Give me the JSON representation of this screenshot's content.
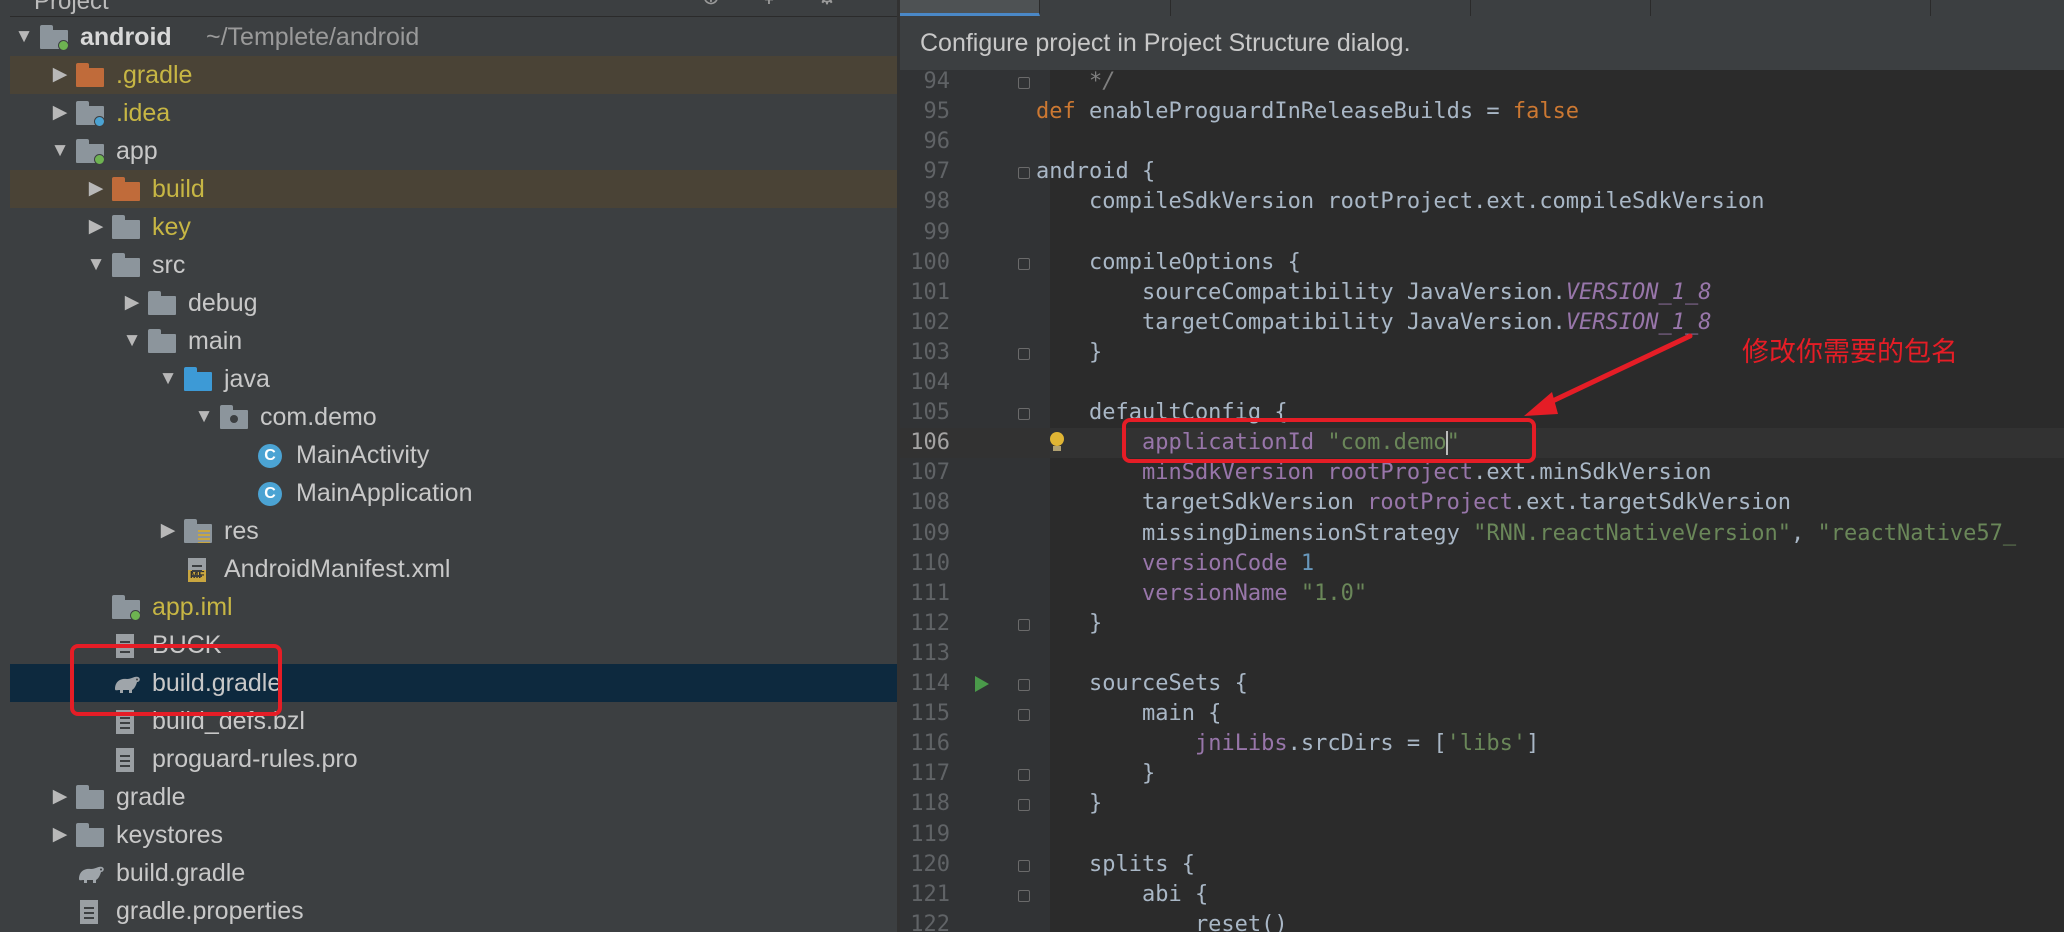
{
  "panel": {
    "title": "Project",
    "tree": [
      {
        "label": "android",
        "path": "~/Templete/android",
        "depth": 0,
        "arrow": "open",
        "icon": "module-folder"
      },
      {
        "label": ".gradle",
        "depth": 1,
        "arrow": "closed",
        "icon": "folder-orange",
        "color": "yellow",
        "highlight": true
      },
      {
        "label": ".idea",
        "depth": 1,
        "arrow": "closed",
        "icon": "idea-folder",
        "color": "yellow"
      },
      {
        "label": "app",
        "depth": 1,
        "arrow": "open",
        "icon": "module-folder"
      },
      {
        "label": "build",
        "depth": 2,
        "arrow": "closed",
        "icon": "folder-orange",
        "color": "yellow",
        "highlight": true
      },
      {
        "label": "key",
        "depth": 2,
        "arrow": "closed",
        "icon": "folder",
        "color": "yellow"
      },
      {
        "label": "src",
        "depth": 2,
        "arrow": "open",
        "icon": "folder"
      },
      {
        "label": "debug",
        "depth": 3,
        "arrow": "closed",
        "icon": "folder"
      },
      {
        "label": "main",
        "depth": 3,
        "arrow": "open",
        "icon": "folder"
      },
      {
        "label": "java",
        "depth": 4,
        "arrow": "open",
        "icon": "folder-blue"
      },
      {
        "label": "com.demo",
        "depth": 5,
        "arrow": "open",
        "icon": "package"
      },
      {
        "label": "MainActivity",
        "depth": 6,
        "icon": "class"
      },
      {
        "label": "MainApplication",
        "depth": 6,
        "icon": "class"
      },
      {
        "label": "res",
        "depth": 4,
        "arrow": "closed",
        "icon": "res-folder"
      },
      {
        "label": "AndroidManifest.xml",
        "depth": 4,
        "icon": "manifest"
      },
      {
        "label": "app.iml",
        "depth": 2,
        "icon": "module-file",
        "color": "yellow"
      },
      {
        "label": "BUCK",
        "depth": 2,
        "icon": "file"
      },
      {
        "label": "build.gradle",
        "depth": 2,
        "icon": "gradle",
        "selected": true
      },
      {
        "label": "build_defs.bzl",
        "depth": 2,
        "icon": "file"
      },
      {
        "label": "proguard-rules.pro",
        "depth": 2,
        "icon": "file"
      },
      {
        "label": "gradle",
        "depth": 1,
        "arrow": "closed",
        "icon": "folder"
      },
      {
        "label": "keystores",
        "depth": 1,
        "arrow": "closed",
        "icon": "folder"
      },
      {
        "label": "build.gradle",
        "depth": 1,
        "icon": "gradle"
      },
      {
        "label": "gradle.properties",
        "depth": 1,
        "icon": "properties"
      }
    ]
  },
  "editor": {
    "banner": "Configure project in Project Structure dialog.",
    "current_line": "106",
    "lines": [
      {
        "n": "94",
        "parts": [
          [
            "cm",
            "    */"
          ]
        ]
      },
      {
        "n": "95",
        "parts": [
          [
            "kw",
            "def "
          ],
          [
            "",
            "enableProguardInReleaseBuilds = "
          ],
          [
            "kw",
            "false"
          ]
        ]
      },
      {
        "n": "96",
        "parts": []
      },
      {
        "n": "97",
        "parts": [
          [
            "",
            "android {"
          ]
        ]
      },
      {
        "n": "98",
        "parts": [
          [
            "",
            "    compileSdkVersion rootProject.ext.compileSdkVersion"
          ]
        ]
      },
      {
        "n": "99",
        "parts": []
      },
      {
        "n": "100",
        "parts": [
          [
            "",
            "    compileOptions {"
          ]
        ]
      },
      {
        "n": "101",
        "parts": [
          [
            "",
            "        sourceCompatibility JavaVersion."
          ],
          [
            "it",
            "VERSION_1_8"
          ]
        ]
      },
      {
        "n": "102",
        "parts": [
          [
            "",
            "        targetCompatibility JavaVersion."
          ],
          [
            "it",
            "VERSION_1_8"
          ]
        ]
      },
      {
        "n": "103",
        "parts": [
          [
            "",
            "    }"
          ]
        ]
      },
      {
        "n": "104",
        "parts": []
      },
      {
        "n": "105",
        "parts": [
          [
            "",
            "    defaultConfig {"
          ]
        ]
      },
      {
        "n": "106",
        "parts": [
          [
            "",
            "        "
          ],
          [
            "prop",
            "applicationId "
          ],
          [
            "str",
            "\"com.demo"
          ],
          [
            "caret",
            ""
          ],
          [
            "str",
            "\""
          ]
        ]
      },
      {
        "n": "107",
        "parts": [
          [
            "",
            "        "
          ],
          [
            "prop",
            "minSdkVersion "
          ],
          [
            "prop",
            "rootProject"
          ],
          [
            "",
            ".ext.minSdkVersion"
          ]
        ]
      },
      {
        "n": "108",
        "parts": [
          [
            "",
            "        targetSdkVersion "
          ],
          [
            "prop",
            "rootProject"
          ],
          [
            "",
            ".ext.targetSdkVersion"
          ]
        ]
      },
      {
        "n": "109",
        "parts": [
          [
            "",
            "        missingDimensionStrategy "
          ],
          [
            "str",
            "\"RNN.reactNativeVersion\""
          ],
          [
            "",
            ", "
          ],
          [
            "str",
            "\"reactNative57_"
          ]
        ]
      },
      {
        "n": "110",
        "parts": [
          [
            "",
            "        "
          ],
          [
            "prop",
            "versionCode "
          ],
          [
            "num",
            "1"
          ]
        ]
      },
      {
        "n": "111",
        "parts": [
          [
            "",
            "        "
          ],
          [
            "prop",
            "versionName "
          ],
          [
            "str",
            "\"1.0\""
          ]
        ]
      },
      {
        "n": "112",
        "parts": [
          [
            "",
            "    }"
          ]
        ]
      },
      {
        "n": "113",
        "parts": []
      },
      {
        "n": "114",
        "parts": [
          [
            "",
            "    sourceSets {"
          ]
        ]
      },
      {
        "n": "115",
        "parts": [
          [
            "",
            "        main {"
          ]
        ]
      },
      {
        "n": "116",
        "parts": [
          [
            "",
            "            "
          ],
          [
            "prop",
            "jniLibs"
          ],
          [
            "",
            ".srcDirs = ["
          ],
          [
            "str",
            "'libs'"
          ],
          [
            "",
            "]"
          ]
        ]
      },
      {
        "n": "117",
        "parts": [
          [
            "",
            "        }"
          ]
        ]
      },
      {
        "n": "118",
        "parts": [
          [
            "",
            "    }"
          ]
        ]
      },
      {
        "n": "119",
        "parts": []
      },
      {
        "n": "120",
        "parts": [
          [
            "",
            "    splits {"
          ]
        ]
      },
      {
        "n": "121",
        "parts": [
          [
            "",
            "        abi {"
          ]
        ]
      },
      {
        "n": "122",
        "parts": [
          [
            "",
            "            reset()"
          ]
        ]
      }
    ]
  },
  "annotation": {
    "text": "修改你需要的包名",
    "color": "#e51d26"
  },
  "colors": {
    "panel_bg": "#3c3f41",
    "editor_bg": "#2b2b2b",
    "selection": "#0d293e",
    "highlight_row": "#4a4336"
  }
}
